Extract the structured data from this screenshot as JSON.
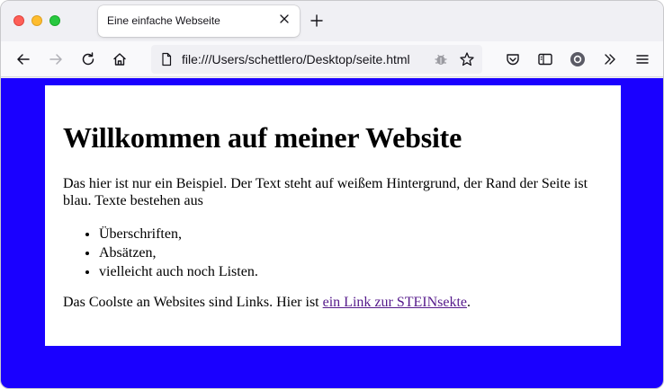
{
  "tab": {
    "title": "Eine einfache Webseite"
  },
  "urlbar": {
    "url": "file:///Users/schettlero/Desktop/seite.html"
  },
  "colors": {
    "page_background": "#1a00ff",
    "content_background": "#ffffff",
    "link_visited": "#551a8b"
  },
  "page": {
    "heading": "Willkommen auf meiner Website",
    "intro": "Das hier ist nur ein Beispiel. Der Text steht auf weißem Hintergrund, der Rand der Seite ist blau. Texte bestehen aus",
    "list": [
      "Überschriften,",
      "Absätzen,",
      "vielleicht auch noch Listen."
    ],
    "outro_before": "Das Coolste an Websites sind Links. Hier ist ",
    "link_text": "ein Link zur STEINsekte",
    "outro_after": "."
  },
  "icons": [
    "close-window-icon",
    "minimize-window-icon",
    "zoom-window-icon",
    "tab-close-icon",
    "new-tab-icon",
    "back-icon",
    "forward-icon",
    "reload-icon",
    "home-icon",
    "page-info-icon",
    "extension-icon",
    "bookmark-star-icon",
    "pocket-icon",
    "reader-view-icon",
    "account-icon",
    "overflow-chevrons-icon",
    "menu-icon"
  ]
}
